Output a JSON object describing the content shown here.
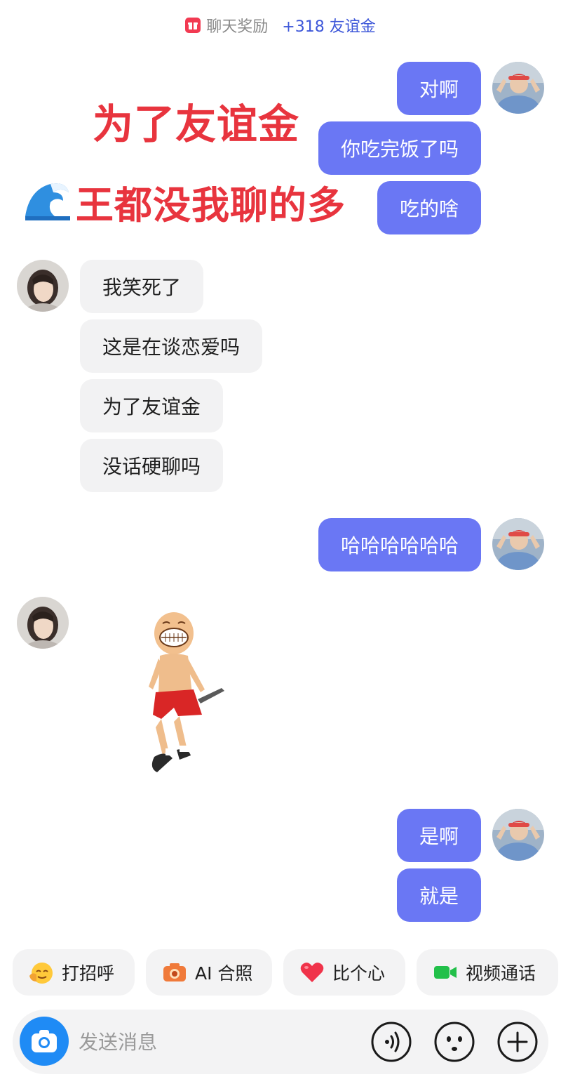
{
  "reward": {
    "label": "聊天奖励",
    "amount": "+318 友谊金"
  },
  "overlay": {
    "line1": "为了友谊金",
    "line2": "王都没我聊的多",
    "emoji_icon": "wave-emoji-icon"
  },
  "messages": {
    "m1": "对啊",
    "m2": "你吃完饭了吗",
    "m3": "吃的啥",
    "m4": "我笑死了",
    "m5": "这是在谈恋爱吗",
    "m6": "为了友谊金",
    "m7": "没话硬聊吗",
    "m8": "哈哈哈哈哈哈",
    "m9": "是啊",
    "m10": "就是"
  },
  "quick_actions": [
    {
      "label": "打招呼",
      "icon": "wave-hand-emoji-icon"
    },
    {
      "label": "AI 合照",
      "icon": "camera-emoji-icon"
    },
    {
      "label": "比个心",
      "icon": "heart-emoji-icon"
    },
    {
      "label": "视频通话",
      "icon": "video-camera-icon"
    }
  ],
  "composer": {
    "placeholder": "发送消息"
  },
  "colors": {
    "me_bubble": "#6a77f4",
    "them_bubble": "#f2f2f3",
    "overlay_text": "#e8343e",
    "reward_accent": "#3d57d9",
    "camera_button": "#1f8bf5"
  }
}
